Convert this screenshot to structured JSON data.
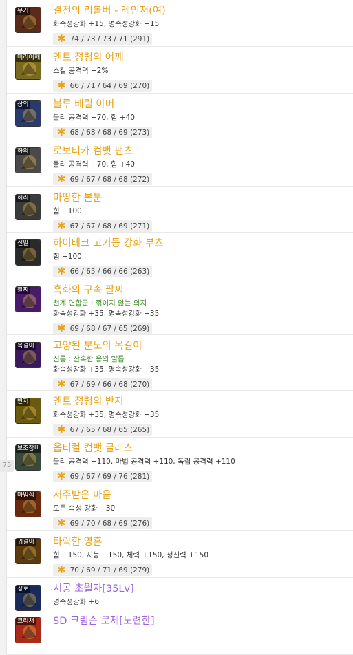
{
  "side_tag": "75",
  "items": [
    {
      "slot": "무기",
      "name": "결전의 리볼버 - 레인저(여)",
      "lines": [
        {
          "text": "화속성강화 +15, 명속성강화 +15",
          "color": "normal"
        }
      ],
      "stat": "74 / 73 / 73 / 71 (291)",
      "name_color": "orange"
    },
    {
      "slot": "머리어깨",
      "name": "엔트 정령의 어깨",
      "lines": [
        {
          "text": "스킬 공격력 +2%",
          "color": "normal"
        }
      ],
      "stat": "66 / 71 / 64 / 69 (270)",
      "name_color": "orange"
    },
    {
      "slot": "상의",
      "name": "블루 베릴 아머",
      "lines": [
        {
          "text": "물리 공격력 +70, 힘 +40",
          "color": "normal"
        }
      ],
      "stat": "68 / 68 / 68 / 69 (273)",
      "name_color": "orange"
    },
    {
      "slot": "하의",
      "name": "로보티카 컴뱃 팬츠",
      "lines": [
        {
          "text": "물리 공격력 +70, 힘 +40",
          "color": "normal"
        }
      ],
      "stat": "69 / 67 / 68 / 68 (272)",
      "name_color": "orange"
    },
    {
      "slot": "허리",
      "name": "마땅한 본분",
      "lines": [
        {
          "text": "힘 +100",
          "color": "normal"
        }
      ],
      "stat": "67 / 67 / 68 / 69 (271)",
      "name_color": "orange"
    },
    {
      "slot": "신발",
      "name": "하이테크 고기동 강화 부츠",
      "lines": [
        {
          "text": "힘 +100",
          "color": "normal"
        }
      ],
      "stat": "66 / 65 / 66 / 66 (263)",
      "name_color": "orange"
    },
    {
      "slot": "팔찌",
      "name": "흑화의 구속 팔찌",
      "lines": [
        {
          "text": "천계 연합군 : 꺾이지 않는 의지",
          "color": "green"
        },
        {
          "text": "화속성강화 +35, 명속성강화 +35",
          "color": "normal"
        }
      ],
      "stat": "69 / 68 / 67 / 65 (269)",
      "name_color": "orange"
    },
    {
      "slot": "목걸이",
      "name": "고양된 분노의 목걸이",
      "lines": [
        {
          "text": "진룡 : 잔혹한 용의 발톱",
          "color": "green"
        },
        {
          "text": "화속성강화 +35, 명속성강화 +35",
          "color": "normal"
        }
      ],
      "stat": "67 / 69 / 66 / 68 (270)",
      "name_color": "orange"
    },
    {
      "slot": "반지",
      "name": "엔트 정령의 반지",
      "lines": [
        {
          "text": "화속성강화 +35, 명속성강화 +35",
          "color": "normal"
        }
      ],
      "stat": "67 / 65 / 68 / 65 (265)",
      "name_color": "orange"
    },
    {
      "slot": "보조장비",
      "name": "옵티컬 컴뱃 글래스",
      "lines": [
        {
          "text": "물리 공격력 +110, 마법 공격력 +110, 독립 공격력 +110",
          "color": "normal"
        }
      ],
      "stat": "69 / 67 / 69 / 76 (281)",
      "name_color": "orange"
    },
    {
      "slot": "마법석",
      "name": "저주받은 마음",
      "lines": [
        {
          "text": "모든 속성 강화 +30",
          "color": "normal"
        }
      ],
      "stat": "69 / 70 / 68 / 69 (276)",
      "name_color": "orange"
    },
    {
      "slot": "귀걸이",
      "name": "타락한 영혼",
      "lines": [
        {
          "text": "힘 +150, 지능 +150, 체력 +150, 정신력 +150",
          "color": "normal"
        }
      ],
      "stat": "70 / 69 / 71 / 69 (279)",
      "name_color": "orange"
    },
    {
      "slot": "칭호",
      "name": "시공 초월자[35Lv]",
      "lines": [
        {
          "text": "명속성강화 +6",
          "color": "normal"
        }
      ],
      "stat": "",
      "name_color": "purple"
    },
    {
      "slot": "크리쳐",
      "name": "SD 크림슨 로제[노련한]",
      "lines": [],
      "stat": "",
      "name_color": "purple"
    }
  ],
  "icon_colors": [
    "#5a2a1a",
    "#7a6a20",
    "#2a3a6a",
    "#4a4a4a",
    "#3a3a3a",
    "#2a2a2a",
    "#4a1a6a",
    "#3a1a5a",
    "#6a5a10",
    "#3a4a3a",
    "#6a2a10",
    "#5a3a10",
    "#1a2a5a",
    "#aa2a1a"
  ],
  "accent": {
    "orange": "#e8a317",
    "purple": "#a062e0",
    "green": "#3c8c28",
    "star": "#e8a317"
  }
}
